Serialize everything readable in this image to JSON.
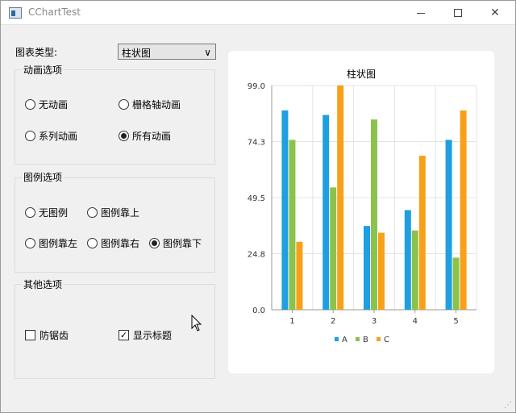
{
  "window": {
    "title": "CChartTest",
    "minimize": "—",
    "maximize": "☐",
    "close": "✕"
  },
  "controls": {
    "chart_type_label": "图表类型:",
    "chart_type_value": "柱状图",
    "chart_type_arrow": "∨"
  },
  "animation_group": {
    "title": "动画选项",
    "options": [
      {
        "label": "无动画",
        "checked": false
      },
      {
        "label": "栅格轴动画",
        "checked": false
      },
      {
        "label": "系列动画",
        "checked": false
      },
      {
        "label": "所有动画",
        "checked": true
      }
    ]
  },
  "legend_group": {
    "title": "图例选项",
    "options": [
      {
        "label": "无图例",
        "checked": false
      },
      {
        "label": "图例靠上",
        "checked": false
      },
      {
        "label": "图例靠左",
        "checked": false
      },
      {
        "label": "图例靠右",
        "checked": false
      },
      {
        "label": "图例靠下",
        "checked": true
      }
    ]
  },
  "other_group": {
    "title": "其他选项",
    "options": [
      {
        "label": "防锯齿",
        "checked": false
      },
      {
        "label": "显示标题",
        "checked": true
      }
    ],
    "check_mark": "✓"
  },
  "chart_data": {
    "type": "bar",
    "title": "柱状图",
    "categories": [
      "1",
      "2",
      "3",
      "4",
      "5"
    ],
    "series": [
      {
        "name": "A",
        "color": "#1e9fe0",
        "values": [
          88,
          86,
          37,
          44,
          75
        ]
      },
      {
        "name": "B",
        "color": "#8bc34a",
        "values": [
          75,
          54,
          84,
          35,
          23
        ]
      },
      {
        "name": "C",
        "color": "#f7a11a",
        "values": [
          30,
          99,
          34,
          68,
          88
        ]
      }
    ],
    "ylim": [
      0,
      99
    ],
    "yticks": [
      "0.0",
      "24.8",
      "49.5",
      "74.3",
      "99.0"
    ],
    "grid": true,
    "legend": "bottom"
  }
}
